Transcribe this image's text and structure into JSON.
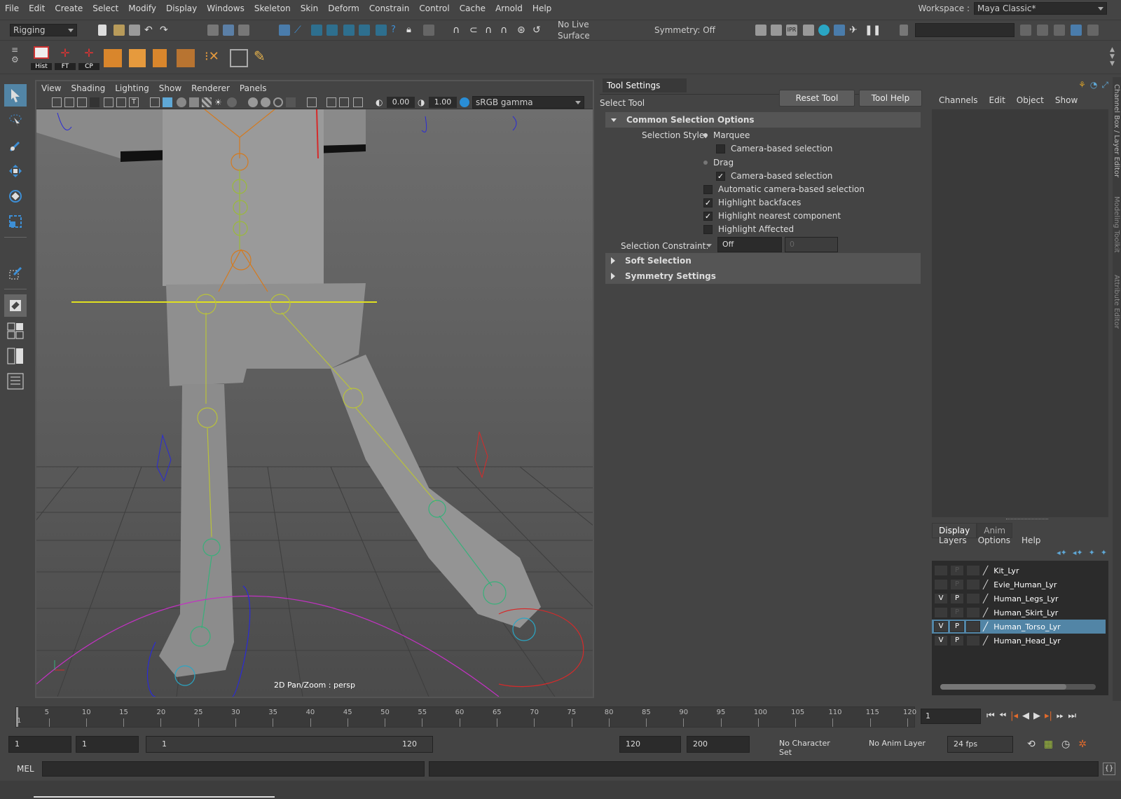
{
  "menubar": {
    "items": [
      "File",
      "Edit",
      "Create",
      "Select",
      "Modify",
      "Display",
      "Windows",
      "Skeleton",
      "Skin",
      "Deform",
      "Constrain",
      "Control",
      "Cache",
      "Arnold",
      "Help"
    ],
    "workspace_label": "Workspace :",
    "workspace_value": "Maya Classic*"
  },
  "statusline": {
    "menuset": "Rigging",
    "live_surface": "No Live Surface",
    "symmetry": "Symmetry: Off"
  },
  "shelf": {
    "buttons": [
      {
        "label": "Hist"
      },
      {
        "label": "FT"
      },
      {
        "label": "CP"
      }
    ]
  },
  "viewport": {
    "menus": [
      "View",
      "Shading",
      "Lighting",
      "Show",
      "Renderer",
      "Panels"
    ],
    "exposure": "0.00",
    "gamma": "1.00",
    "color_space": "sRGB gamma",
    "label": "2D Pan/Zoom : persp"
  },
  "tool_settings": {
    "header": "Tool Settings",
    "tool_name": "Select Tool",
    "reset_button": "Reset Tool",
    "help_button": "Tool Help",
    "common_section": "Common Selection Options",
    "selection_style_label": "Selection Style:",
    "marquee": "Marquee",
    "camera_based_1": "Camera-based selection",
    "drag": "Drag",
    "camera_based_2": "Camera-based selection",
    "auto_camera": "Automatic camera-based selection",
    "highlight_backfaces": "Highlight backfaces",
    "highlight_nearest": "Highlight nearest component",
    "highlight_affected": "Highlight Affected",
    "constraint_label": "Selection Constraint:",
    "constraint_value": "Off",
    "constraint_num": "0",
    "soft_section": "Soft Selection",
    "symmetry_section": "Symmetry Settings"
  },
  "channel_box": {
    "menus": [
      "Channels",
      "Edit",
      "Object",
      "Show"
    ],
    "tabs": [
      "Display",
      "Anim"
    ],
    "layer_menus": [
      "Layers",
      "Options",
      "Help"
    ],
    "layers": [
      {
        "v": "",
        "p": "P",
        "name": "Kit_Lyr",
        "selected": false
      },
      {
        "v": "",
        "p": "P",
        "name": "Evie_Human_Lyr",
        "selected": false
      },
      {
        "v": "V",
        "p": "P",
        "name": "Human_Legs_Lyr",
        "selected": false
      },
      {
        "v": "",
        "p": "P",
        "name": "Human_Skirt_Lyr",
        "selected": false
      },
      {
        "v": "V",
        "p": "P",
        "name": "Human_Torso_Lyr",
        "selected": true
      },
      {
        "v": "V",
        "p": "P",
        "name": "Human_Head_Lyr",
        "selected": false
      }
    ]
  },
  "side_tabs": [
    "Channel Box / Layer Editor",
    "Modeling Toolkit",
    "Attribute Editor"
  ],
  "timeline": {
    "ticks": [
      "5",
      "10",
      "15",
      "20",
      "25",
      "30",
      "35",
      "40",
      "45",
      "50",
      "55",
      "60",
      "65",
      "70",
      "75",
      "80",
      "85",
      "90",
      "95",
      "100",
      "105",
      "110",
      "115",
      "120"
    ],
    "start_tick": "1",
    "current_frame": "1"
  },
  "range": {
    "start": "1",
    "playback_start": "1",
    "slider_start": "1",
    "slider_end": "120",
    "playback_end": "120",
    "end": "200",
    "character_set": "No Character Set",
    "anim_layer": "No Anim Layer",
    "fps": "24 fps"
  },
  "command": {
    "mel_label": "MEL"
  }
}
